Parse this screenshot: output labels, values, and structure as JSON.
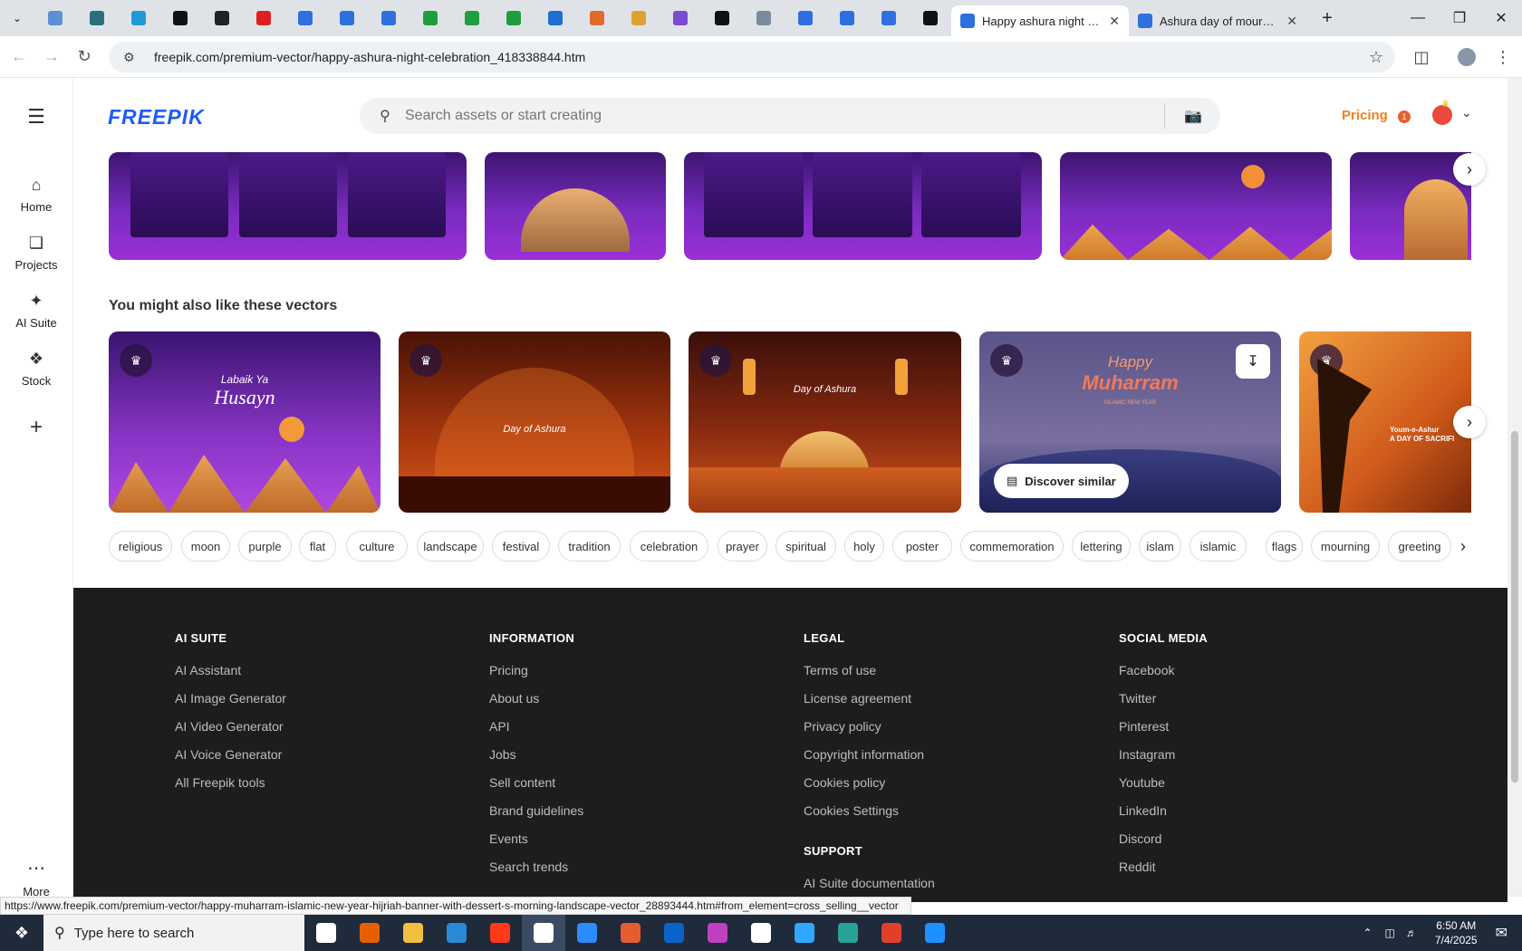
{
  "browser": {
    "active_tab_title": "Happy ashura night celebration",
    "second_tab_title": "Ashura day of mourning",
    "url": "freepik.com/premium-vector/happy-ashura-night-celebration_418338844.htm",
    "pinned_favicon_colors": [
      "#5b8fd6",
      "#2a6f7a",
      "#1f9ad6",
      "#111111",
      "#222222",
      "#e02020",
      "#2f6fe0",
      "#2f6fe0",
      "#2f6fe0",
      "#1e9e3e",
      "#1e9e3e",
      "#1e9e3e",
      "#1e6fd0",
      "#e06a2a",
      "#e0a030",
      "#7a4ad0",
      "#111111",
      "#7a8ba0",
      "#2f6fe0",
      "#2f6fe0",
      "#2f6fe0",
      "#111111"
    ]
  },
  "rail": {
    "home": "Home",
    "projects": "Projects",
    "ai_suite": "AI Suite",
    "stock": "Stock",
    "more": "More"
  },
  "header": {
    "logo": "FREEPIK",
    "search_placeholder": "Search assets or start creating",
    "pricing": "Pricing",
    "notif_count": "1"
  },
  "section": {
    "title": "You might also like these vectors"
  },
  "cards": [
    {
      "line1": "Labaik Ya",
      "line2": "Husayn"
    },
    {
      "line1": "",
      "line2": "Day of Ashura"
    },
    {
      "line1": "",
      "line2": "Day of Ashura"
    },
    {
      "line1": "Happy",
      "line2": "Muharram",
      "line3": "ISLAMIC NEW YEAR",
      "discover": "Discover similar"
    },
    {
      "line1": "Youm-e-Ashur",
      "line2": "A DAY OF SACRIFI"
    }
  ],
  "tags": [
    "religious",
    "moon",
    "purple",
    "flat",
    "culture",
    "landscape",
    "festival",
    "tradition",
    "celebration",
    "prayer",
    "spiritual",
    "holy",
    "poster",
    "commemoration",
    "lettering",
    "islam",
    "islamic",
    "flags",
    "mourning",
    "greeting"
  ],
  "footer": {
    "ai_suite": {
      "heading": "AI SUITE",
      "links": [
        "AI Assistant",
        "AI Image Generator",
        "AI Video Generator",
        "AI Voice Generator",
        "All Freepik tools"
      ]
    },
    "information": {
      "heading": "INFORMATION",
      "links": [
        "Pricing",
        "About us",
        "API",
        "Jobs",
        "Sell content",
        "Brand guidelines",
        "Events",
        "Search trends"
      ]
    },
    "legal": {
      "heading": "LEGAL",
      "links": [
        "Terms of use",
        "License agreement",
        "Privacy policy",
        "Copyright information",
        "Cookies policy",
        "Cookies Settings"
      ]
    },
    "support": {
      "heading": "SUPPORT",
      "links": [
        "AI Suite documentation"
      ]
    },
    "social": {
      "heading": "SOCIAL MEDIA",
      "links": [
        "Facebook",
        "Twitter",
        "Pinterest",
        "Instagram",
        "Youtube",
        "LinkedIn",
        "Discord",
        "Reddit"
      ]
    }
  },
  "status_url": "https://www.freepik.com/premium-vector/happy-muharram-islamic-new-year-hijriah-banner-with-dessert-s-morning-landscape-vector_28893444.htm#from_element=cross_selling__vector",
  "taskbar": {
    "search_placeholder": "Type here to search",
    "time": "6:50 AM",
    "date": "7/4/2025",
    "app_colors": [
      "#ffffff",
      "#e66000",
      "#f0c040",
      "#2a8ad6",
      "#ff3a1a",
      "#ffffff",
      "#2d8cff",
      "#e35d2f",
      "#0a64c8",
      "#c040c0",
      "#ffffff",
      "#31a8ff",
      "#2aa198",
      "#e0402a",
      "#1e90ff"
    ]
  }
}
